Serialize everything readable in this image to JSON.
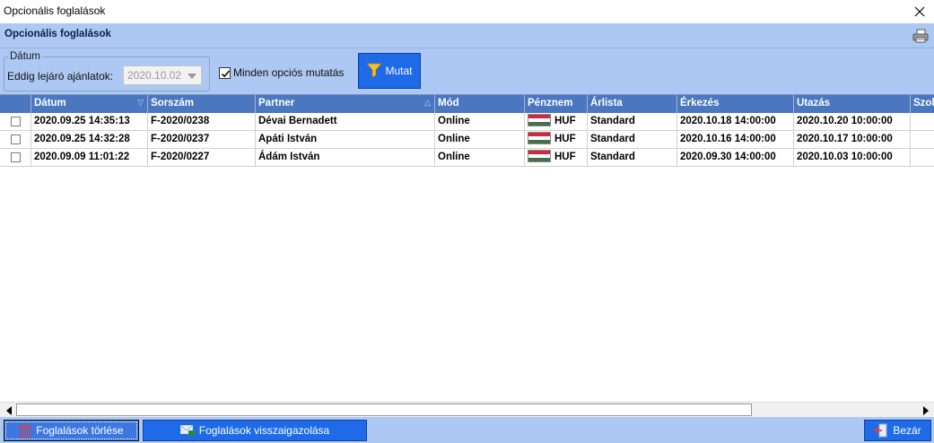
{
  "window": {
    "title": "Opcionális foglalások"
  },
  "header": {
    "title": "Opcionális foglalások"
  },
  "filter": {
    "group_label": "Dátum",
    "expiry_label": "Eddig lejáró ajánlatok:",
    "expiry_value": "2020.10.02",
    "show_all_label": "Minden opciós mutatás",
    "show_all_checked": true,
    "show_button": "Mutat"
  },
  "grid": {
    "columns": [
      "",
      "Dátum",
      "Sorszám",
      "Partner",
      "Mód",
      "Pénznem",
      "Árlista",
      "Érkezés",
      "Utazás",
      "Szob"
    ],
    "rows": [
      {
        "checked": false,
        "datum": "2020.09.25 14:35:13",
        "sorszam": "F-2020/0238",
        "partner": "Dévai  Bernadett",
        "mod": "Online",
        "penznem": "HUF",
        "arlista": "Standard",
        "erkezes": "2020.10.18 14:00:00",
        "utazas": "2020.10.20 10:00:00"
      },
      {
        "checked": false,
        "datum": "2020.09.25 14:32:28",
        "sorszam": "F-2020/0237",
        "partner": "Apáti István",
        "mod": "Online",
        "penznem": "HUF",
        "arlista": "Standard",
        "erkezes": "2020.10.16 14:00:00",
        "utazas": "2020.10.17 10:00:00"
      },
      {
        "checked": false,
        "datum": "2020.09.09 11:01:22",
        "sorszam": "F-2020/0227",
        "partner": "Ádám  István",
        "mod": "Online",
        "penznem": "HUF",
        "arlista": "Standard",
        "erkezes": "2020.09.30 14:00:00",
        "utazas": "2020.10.03 10:00:00"
      }
    ]
  },
  "footer": {
    "delete_button": "Foglalások törlése",
    "confirm_button": "Foglalások visszaigazolása",
    "close_button": "Bezár"
  },
  "colors": {
    "accent": "#1f6be7",
    "band": "#adc8f3",
    "grid_header": "#4a77c0"
  }
}
